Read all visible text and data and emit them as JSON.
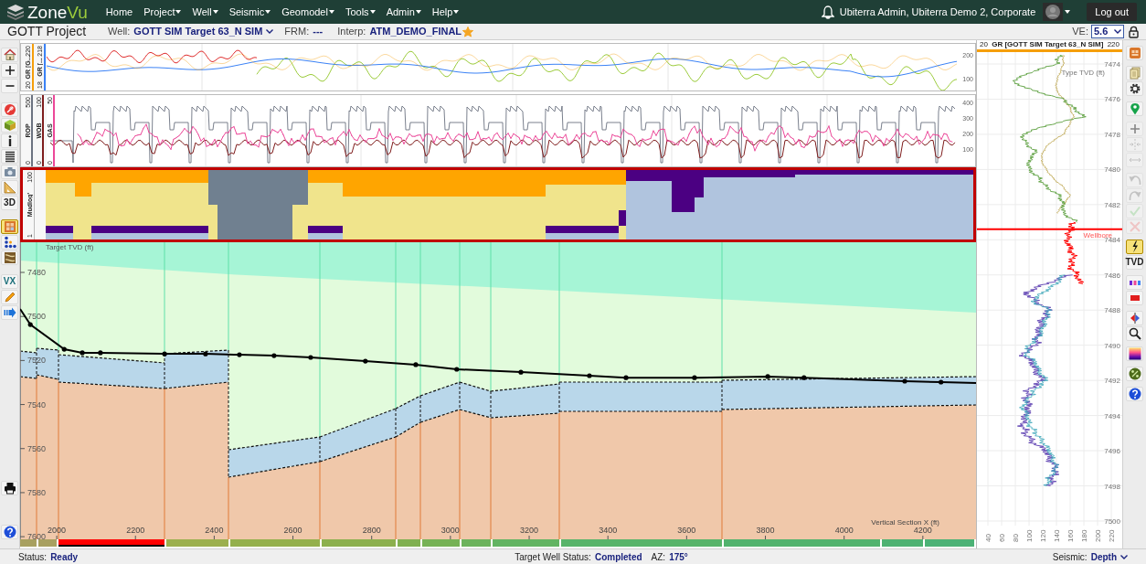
{
  "app": {
    "logo_first": "Zone",
    "logo_second": "Vu"
  },
  "nav": [
    {
      "label": "Home",
      "dropdown": false
    },
    {
      "label": "Project",
      "dropdown": true
    },
    {
      "label": "Well",
      "dropdown": true
    },
    {
      "label": "Seismic",
      "dropdown": true
    },
    {
      "label": "Geomodel",
      "dropdown": true
    },
    {
      "label": "Tools",
      "dropdown": true
    },
    {
      "label": "Admin",
      "dropdown": true
    },
    {
      "label": "Help",
      "dropdown": true
    }
  ],
  "user": {
    "name": "Ubiterra Admin, Ubiterra Demo 2, Corporate",
    "logout": "Log out"
  },
  "subbar": {
    "project": "GOTT Project",
    "well_label": "Well:",
    "well": "GOTT SIM Target 63_N SIM",
    "frm_label": "FRM:",
    "frm": "---",
    "interp_label": "Interp:",
    "interp": "ATM_DEMO_FINAL",
    "favorite": true,
    "ve_label": "VE:",
    "ve": "5.6",
    "locked": true
  },
  "left_toolbar": [
    [
      {
        "selected": false
      },
      {
        "selected": false
      },
      {
        "selected": false
      }
    ],
    [
      {
        "selected": false
      },
      {
        "selected": false
      },
      {
        "selected": false
      },
      {
        "selected": false
      },
      {
        "selected": false
      },
      {
        "selected": false
      },
      {
        "label": "3D",
        "selected": false
      }
    ],
    [
      {
        "selected": true
      },
      {
        "selected": false
      },
      {
        "selected": false
      }
    ],
    [
      {
        "label": "VX",
        "selected": false
      },
      {
        "selected": false
      },
      {
        "selected": false
      }
    ],
    [
      {
        "selected": false
      }
    ],
    [
      {
        "selected": false
      }
    ]
  ],
  "gr_track": {
    "curves": [
      {
        "name": "GR [G...",
        "min": "20",
        "max": "220",
        "color": "#f59e0b"
      },
      {
        "name": "GR [...",
        "min": "18",
        "max": "218",
        "color": "#3b82f6"
      }
    ],
    "ticks": [
      "200",
      "100"
    ]
  },
  "drill_track": {
    "curves": [
      {
        "name": "ROP",
        "min": "0",
        "max": "500",
        "color": "#6b7280"
      },
      {
        "name": "WOB",
        "min": "0",
        "max": "100",
        "color": "#7f1d1d"
      },
      {
        "name": "GAS",
        "min": "0",
        "max": "50",
        "color": "#ec4899"
      }
    ],
    "ticks": [
      "400",
      "300",
      "200",
      "100"
    ]
  },
  "mudlog": {
    "name": "Mudlog'",
    "max": "100",
    "min": "1",
    "highlighted": true
  },
  "cross_section": {
    "chart_data": {
      "type": "line",
      "xlabel": "Vertical Section X (ft)",
      "ylabel": "Target TVD (ft)",
      "x": [
        1907,
        1933,
        2019,
        2065,
        2111,
        2274,
        2378,
        2464,
        2552,
        2645,
        2784,
        2912,
        3016,
        3179,
        3353,
        3446,
        3620,
        3806,
        3898,
        4154,
        4246,
        4335
      ],
      "series": [
        {
          "color": "#000000",
          "values": [
            7496.6,
            7503.7,
            7514.9,
            7516.5,
            7516.5,
            7517.0,
            7517.0,
            7517.4,
            7517.8,
            7518.6,
            7520.3,
            7521.9,
            7524.0,
            7525.3,
            7526.9,
            7527.8,
            7527.8,
            7527.3,
            7527.8,
            7529.4,
            7529.8,
            7530.2
          ]
        }
      ],
      "xlim": [
        1907,
        4335
      ],
      "ylim": [
        7601.2,
        7466.3
      ],
      "xticks": [
        2000,
        2200,
        2400,
        2600,
        2800,
        3000,
        3200,
        3400,
        3600,
        3800,
        4000,
        4200
      ],
      "yticks": [
        7480,
        7500,
        7520,
        7540,
        7560,
        7580,
        7600
      ]
    }
  },
  "section_bar": [
    {
      "color": "#a8a060",
      "selected": false
    },
    {
      "color": "#a8a060",
      "selected": false
    },
    {
      "color": "#ff0000",
      "selected": true
    },
    {
      "color": "#9cb04e",
      "selected": false
    },
    {
      "color": "#94b04c",
      "selected": false
    },
    {
      "color": "#8cb04e",
      "selected": false
    },
    {
      "color": "#80b050",
      "selected": false
    },
    {
      "color": "#76b255",
      "selected": false
    },
    {
      "color": "#6cb35c",
      "selected": false
    },
    {
      "color": "#62b462",
      "selected": false
    },
    {
      "color": "#58b46a",
      "selected": false
    },
    {
      "color": "#52b36e",
      "selected": false
    },
    {
      "color": "#4eb272",
      "selected": false
    },
    {
      "color": "#4cb276",
      "selected": false
    }
  ],
  "type_log": {
    "min": "20",
    "title": "GR [GOTT SIM Target 63_N SIM]",
    "max": "220",
    "axis_title": "Type TVD (ft)",
    "depth_ticks": [
      "7474",
      "7476",
      "7478",
      "7480",
      "7482",
      "7484",
      "7486",
      "7488",
      "7490",
      "7492",
      "7494",
      "7496",
      "7498",
      "7500"
    ],
    "gr_ticks": [
      "40",
      "60",
      "80",
      "100",
      "120",
      "140",
      "160",
      "180",
      "200",
      "220"
    ],
    "wellbore_label": "Wellbore"
  },
  "right_toolbar": [
    [
      {
        "selected": false,
        "disabled": false
      }
    ],
    [
      {
        "selected": false,
        "disabled": false
      },
      {
        "selected": false,
        "disabled": false
      }
    ],
    [
      {
        "selected": false,
        "disabled": false
      }
    ],
    [
      {
        "selected": false,
        "disabled": true
      },
      {
        "selected": false,
        "disabled": true
      },
      {
        "selected": false,
        "disabled": true
      }
    ],
    [
      {
        "selected": false,
        "disabled": true
      },
      {
        "selected": false,
        "disabled": true
      },
      {
        "selected": false,
        "disabled": true
      },
      {
        "selected": false,
        "disabled": true
      }
    ],
    [
      {
        "selected": true,
        "disabled": false
      },
      {
        "label": "TVD",
        "selected": false,
        "disabled": false
      }
    ],
    [
      {
        "selected": false,
        "disabled": false
      },
      {
        "selected": false,
        "disabled": false
      }
    ],
    [
      {
        "selected": false,
        "disabled": false
      },
      {
        "selected": false,
        "disabled": false
      }
    ],
    [
      {
        "selected": false,
        "disabled": false
      }
    ],
    [
      {
        "selected": false,
        "disabled": false
      }
    ],
    [
      {
        "selected": false,
        "disabled": false
      }
    ]
  ],
  "status_bar": {
    "status_label": "Status:",
    "status": "Ready",
    "target_label": "Target Well Status:",
    "target": "Completed",
    "az_label": "AZ:",
    "az": "175°",
    "seismic_label": "Seismic:",
    "seismic": "Depth"
  }
}
